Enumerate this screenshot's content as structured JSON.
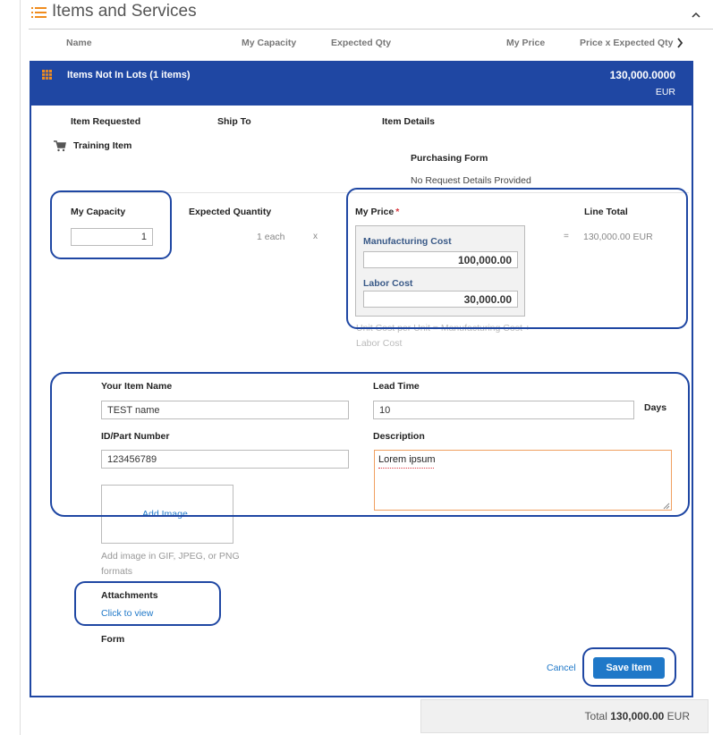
{
  "section": {
    "title": "Items and Services"
  },
  "columns": [
    "Name",
    "My Capacity",
    "Expected Qty",
    "My Price",
    "Price x Expected Qty"
  ],
  "lots": {
    "label": "Items Not In Lots (1 items)",
    "amount": "130,000.0000",
    "currency": "EUR"
  },
  "details_headers": {
    "requested": "Item Requested",
    "ship_to": "Ship To",
    "item_details": "Item Details"
  },
  "item": {
    "name": "Training Item"
  },
  "purchasing": {
    "title": "Purchasing Form",
    "note": "No Request Details Provided"
  },
  "capacity": {
    "label": "My Capacity",
    "value": "1"
  },
  "expected": {
    "label": "Expected Quantity",
    "value": "1 each",
    "times": "x"
  },
  "price": {
    "label": "My Price",
    "required": "*",
    "mfg_label": "Manufacturing Cost",
    "mfg_value": "100,000.00",
    "labor_label": "Labor Cost",
    "labor_value": "30,000.00",
    "formula_line1": "Unit Cost per Unit = Manufacturing Cost +",
    "formula_line2": "Labor Cost"
  },
  "line_total": {
    "label": "Line Total",
    "equals": "=",
    "value": "130,000.00",
    "currency": "EUR"
  },
  "form": {
    "item_name_label": "Your Item Name",
    "item_name_value": "TEST name",
    "lead_time_label": "Lead Time",
    "lead_time_value": "10",
    "days": "Days",
    "part_label": "ID/Part Number",
    "part_value": "123456789",
    "desc_label": "Description",
    "desc_value": "Lorem ipsum"
  },
  "image": {
    "add_label": "Add Image",
    "hint_line1": "Add image in GIF, JPEG, or PNG",
    "hint_line2": "formats"
  },
  "attachments": {
    "label": "Attachments",
    "link": "Click to view"
  },
  "form_label": "Form",
  "actions": {
    "cancel": "Cancel",
    "save": "Save Item"
  },
  "total": {
    "label": "Total",
    "value": "130,000.00",
    "currency": "EUR"
  },
  "colors": {
    "primary": "#1f47a3",
    "button": "#1f78c8",
    "link": "#1f78c8",
    "accent": "#f08c1e"
  }
}
